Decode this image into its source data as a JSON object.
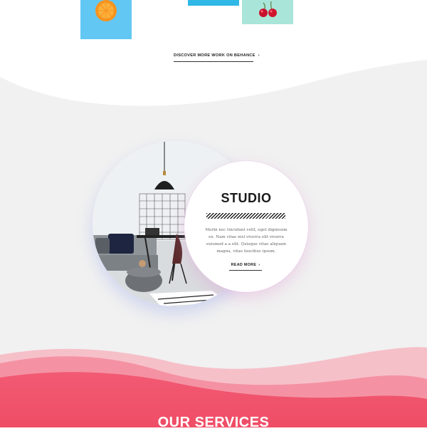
{
  "portfolio": {
    "tiles": [
      {
        "name": "orange-slice",
        "color": "#63c7f3"
      },
      {
        "name": "teal-card",
        "color": "#2fb7e6"
      },
      {
        "name": "cherries",
        "color": "#a9e5d8"
      }
    ],
    "behance_link": "DISCOVER MORE WORK ON BEHANCE",
    "chevron_icon": "chevron-right-icon"
  },
  "studio": {
    "title": "STUDIO",
    "body": "Morbi nec tincidunt velit, eget dignissim ex. Nam vitae nisl viverra elit viverra euismod a a elit. Quisque vitae aliquam magna, vitae faucibus ipsum.",
    "read_more": "READ MORE"
  },
  "services": {
    "title": "OUR SERVICES"
  },
  "colors": {
    "section_gray": "#f1f1f1",
    "pink_light": "#f4b7c1",
    "pink_mid": "#f38a9c",
    "pink_strong": "#f0506a",
    "text_dark": "#1a1a1a"
  }
}
